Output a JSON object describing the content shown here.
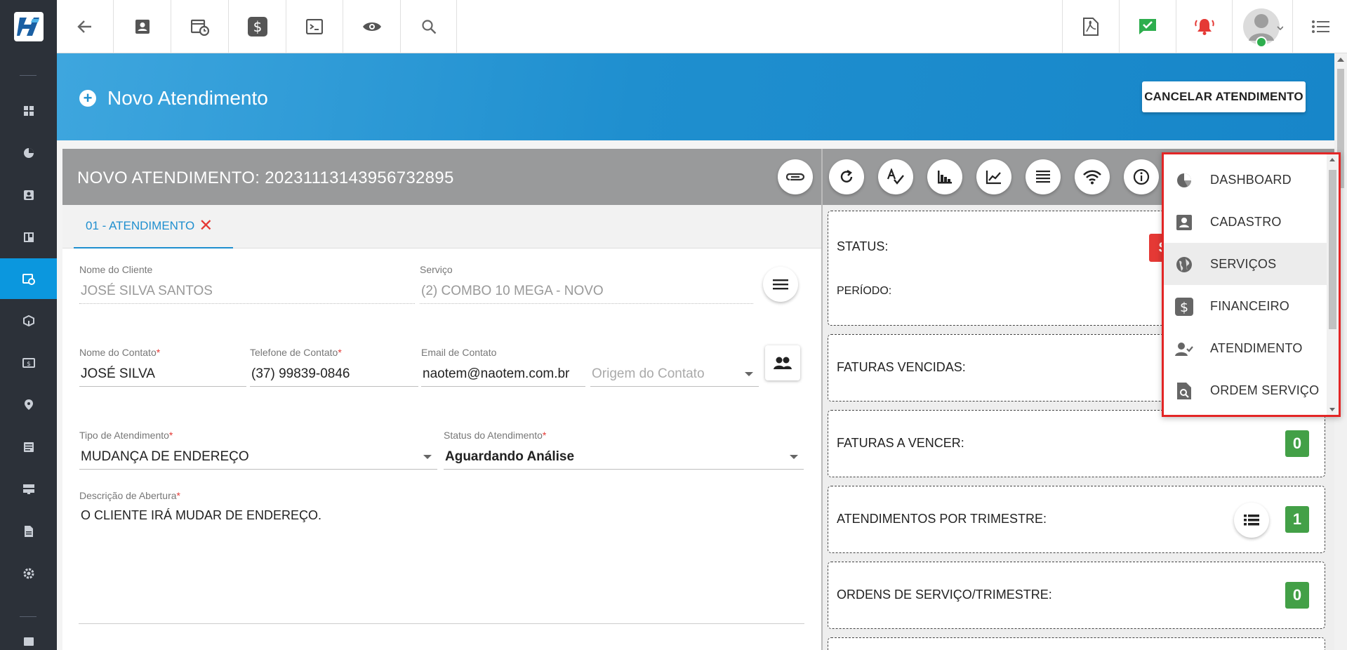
{
  "topbar": {
    "avatar_menu": "user-avatar"
  },
  "hero": {
    "title": "Novo Atendimento",
    "cancel_label": "CANCELAR ATENDIMENTO"
  },
  "panel": {
    "title": "NOVO ATENDIMENTO: 20231113143956732895",
    "tab_label": "01 - ATENDIMENTO",
    "tab_close": "✕"
  },
  "form": {
    "cliente": {
      "label": "Nome do Cliente",
      "value": "JOSÉ SILVA SANTOS"
    },
    "servico": {
      "label": "Serviço",
      "value": "(2) COMBO 10 MEGA - NOVO"
    },
    "contato": {
      "label": "Nome do Contato",
      "value": "JOSÉ SILVA"
    },
    "telefone": {
      "label": "Telefone de Contato",
      "value": "(37) 99839-0846"
    },
    "email": {
      "label": "Email de Contato",
      "value": "naotem@naotem.com.br"
    },
    "origem": {
      "placeholder": "Origem do Contato"
    },
    "tipo": {
      "label": "Tipo de Atendimento",
      "value": "MUDANÇA DE ENDEREÇO"
    },
    "status": {
      "label": "Status do Atendimento",
      "value": "Aguardando Análise"
    },
    "descricao": {
      "label": "Descrição de Abertura",
      "value": "O CLIENTE IRÁ MUDAR DE ENDEREÇO."
    },
    "required_mark": "*"
  },
  "cards": {
    "status_label": "STATUS:",
    "status_badge": "S",
    "periodo_label": "PERÍODO:",
    "faturas_vencidas_label": "FATURAS VENCIDAS:",
    "faturas_a_vencer_label": "FATURAS A VENCER:",
    "faturas_a_vencer_value": "0",
    "atendimentos_label": "ATENDIMENTOS POR TRIMESTRE:",
    "atendimentos_value": "1",
    "ordens_label": "ORDENS DE SERVIÇO/TRIMESTRE:",
    "ordens_value": "0"
  },
  "dropdown": {
    "items": [
      {
        "label": "DASHBOARD",
        "icon": "pie-chart-icon"
      },
      {
        "label": "CADASTRO",
        "icon": "contact-card-icon"
      },
      {
        "label": "SERVIÇOS",
        "icon": "globe-icon"
      },
      {
        "label": "FINANCEIRO",
        "icon": "dollar-icon"
      },
      {
        "label": "ATENDIMENTO",
        "icon": "person-check-icon"
      },
      {
        "label": "ORDEM SERVIÇO",
        "icon": "document-search-icon"
      }
    ],
    "active_index": 2
  },
  "colors": {
    "brand_blue": "#1f8fcf",
    "sidebar_bg": "#2c3139",
    "active_sidebar": "#0b97de",
    "highlight_red": "#e32626",
    "badge_green": "#43a047"
  }
}
